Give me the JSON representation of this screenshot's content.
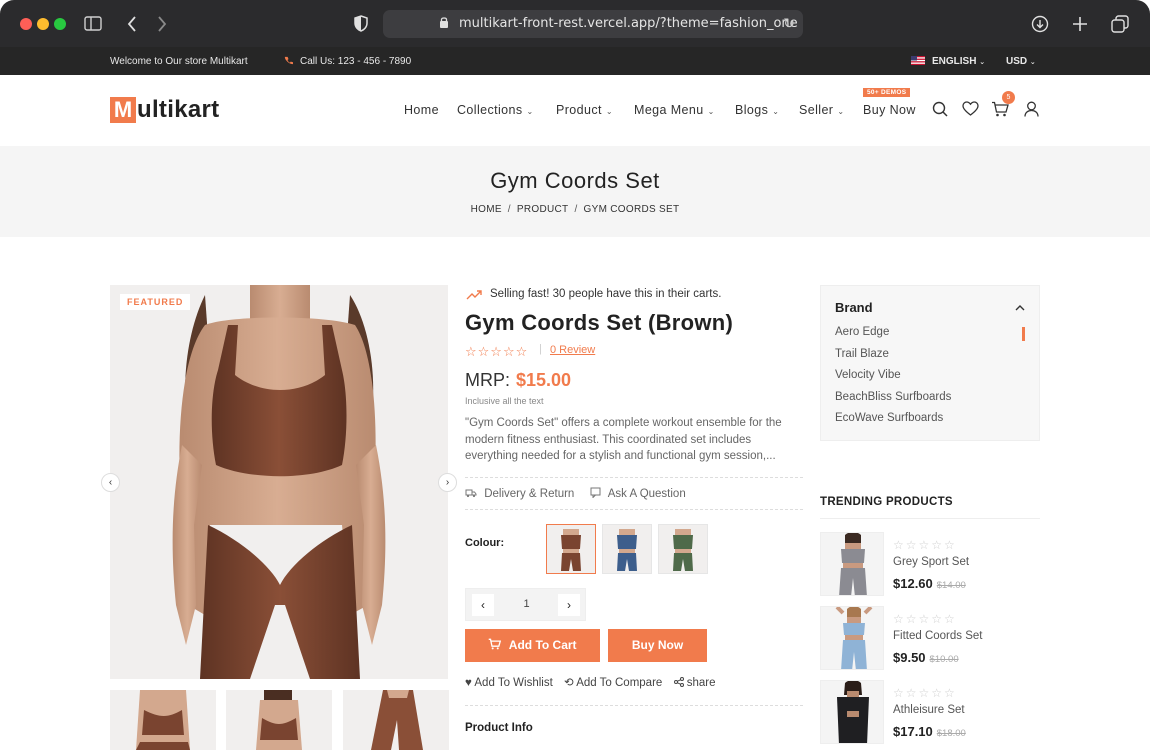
{
  "browser": {
    "url": "multikart-front-rest.vercel.app/?theme=fashion_one"
  },
  "topbar": {
    "welcome": "Welcome to Our store Multikart",
    "call": "Call Us: 123 - 456 - 7890",
    "language": "ENGLISH",
    "currency": "USD"
  },
  "header": {
    "logo_initial": "M",
    "logo_rest": "ultikart",
    "nav": [
      {
        "label": "Home",
        "has_menu": false
      },
      {
        "label": "Collections",
        "has_menu": true
      },
      {
        "label": "Product",
        "has_menu": true
      },
      {
        "label": "Mega Menu",
        "has_menu": true
      },
      {
        "label": "Blogs",
        "has_menu": true
      },
      {
        "label": "Seller",
        "has_menu": true
      },
      {
        "label": "Buy Now",
        "has_menu": false
      }
    ],
    "demos_badge": "50+ DEMOS",
    "cart_count": "5"
  },
  "banner": {
    "title": "Gym Coords Set",
    "breadcrumb": [
      "HOME",
      "PRODUCT",
      "GYM COORDS SET"
    ]
  },
  "gallery": {
    "featured_label": "FEATURED",
    "prev": "‹",
    "next": "›"
  },
  "product": {
    "selling_note": "Selling fast! 30 people have this in their carts.",
    "name": "Gym Coords Set (Brown)",
    "stars": "☆☆☆☆☆",
    "review_link": "0 Review",
    "mrp_label": "MRP:",
    "price": "$15.00",
    "inclusive": "Inclusive all the text",
    "description": "\"Gym Coords Set\" offers a complete workout ensemble for the modern fitness enthusiast. This coordinated set includes everything needed for a stylish and functional gym session,...",
    "delivery_link": "Delivery & Return",
    "ask_link": "Ask A Question",
    "colour_label": "Colour:",
    "quantity": "1",
    "qty_minus": "‹",
    "qty_plus": "›",
    "add_to_cart": "Add To Cart",
    "buy_now": "Buy Now",
    "wishlist": "Add To Wishlist",
    "compare": "Add To Compare",
    "share": "share",
    "product_info": "Product Info"
  },
  "brand_filter": {
    "title": "Brand",
    "items": [
      "Aero Edge",
      "Trail Blaze",
      "Velocity Vibe",
      "BeachBliss Surfboards",
      "EcoWave Surfboards"
    ]
  },
  "trending": {
    "title": "TRENDING PRODUCTS",
    "items": [
      {
        "stars": "☆☆☆☆☆",
        "name": "Grey Sport Set",
        "price": "$12.60",
        "old_price": "$14.00"
      },
      {
        "stars": "☆☆☆☆☆",
        "name": "Fitted Coords Set",
        "price": "$9.50",
        "old_price": "$10.00"
      },
      {
        "stars": "☆☆☆☆☆",
        "name": "Athleisure Set",
        "price": "$17.10",
        "old_price": "$18.00"
      }
    ]
  },
  "colors": {
    "accent": "#f17b4c",
    "brown": "#7a4430",
    "blue": "#3d5e8c",
    "green": "#4f6a4a",
    "grey": "#8b8b92"
  }
}
